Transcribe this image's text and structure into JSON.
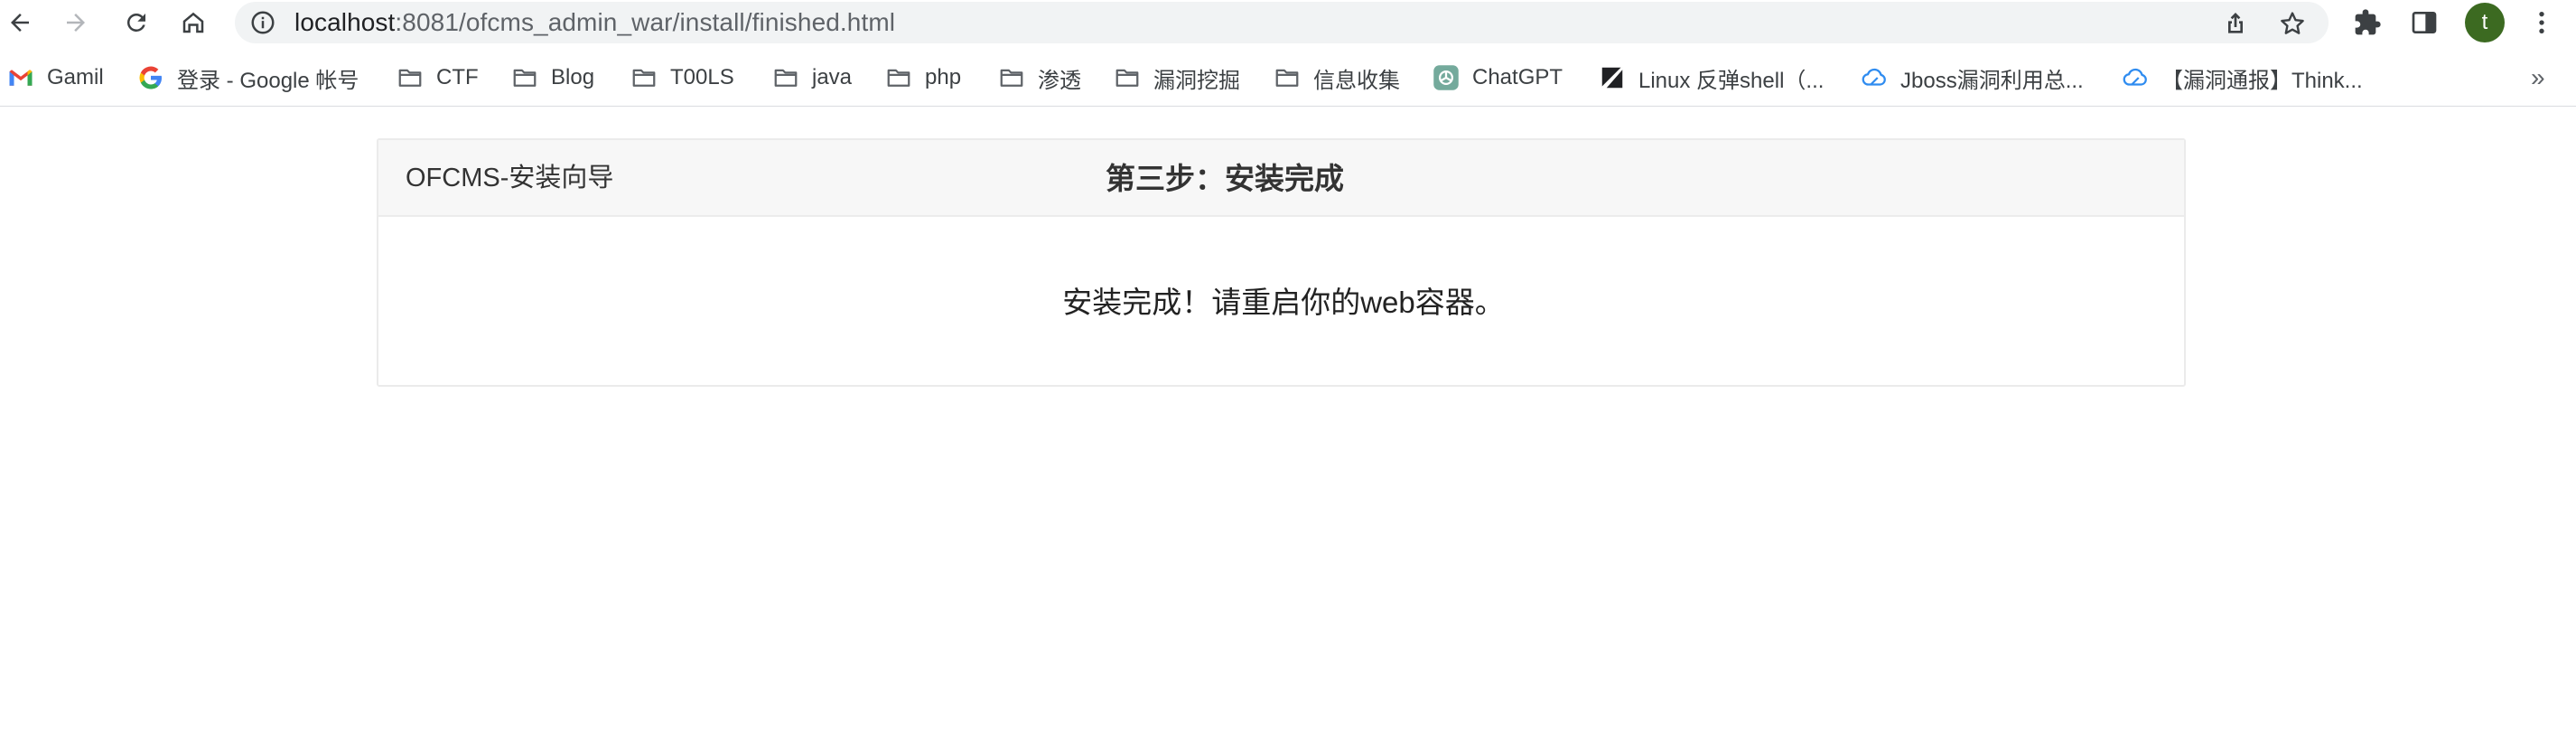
{
  "browser": {
    "url_host": "localhost",
    "url_path": ":8081/ofcms_admin_war/install/finished.html",
    "avatar_letter": "t",
    "icons": [
      "back-icon",
      "forward-icon",
      "reload-icon",
      "home-icon",
      "site-info-icon",
      "share-icon",
      "star-icon",
      "extensions-icon",
      "side-panel-icon",
      "menu-icon"
    ],
    "avatar_color": "#3c6a21"
  },
  "bookmarks": {
    "items": [
      {
        "label": "Gamil",
        "icon": "gmail-icon"
      },
      {
        "label": "登录 - Google 帐号",
        "icon": "google-icon"
      },
      {
        "label": "CTF",
        "icon": "folder-icon"
      },
      {
        "label": "Blog",
        "icon": "folder-icon"
      },
      {
        "label": "T00LS",
        "icon": "folder-icon"
      },
      {
        "label": "java",
        "icon": "folder-icon"
      },
      {
        "label": "php",
        "icon": "folder-icon"
      },
      {
        "label": "渗透",
        "icon": "folder-icon"
      },
      {
        "label": "漏洞挖掘",
        "icon": "folder-icon"
      },
      {
        "label": "信息收集",
        "icon": "folder-icon"
      },
      {
        "label": "ChatGPT",
        "icon": "chatgpt-icon"
      },
      {
        "label": "Linux 反弹shell（...",
        "icon": "linux-site-icon"
      },
      {
        "label": "Jboss漏洞利用总...",
        "icon": "cloud-icon"
      },
      {
        "label": "【漏洞通报】Think...",
        "icon": "cloud-icon"
      }
    ],
    "more": "»"
  },
  "page": {
    "title": "OFCMS-安装向导",
    "step": "第三步：安装完成",
    "message": "安装完成！请重启你的web容器。"
  }
}
